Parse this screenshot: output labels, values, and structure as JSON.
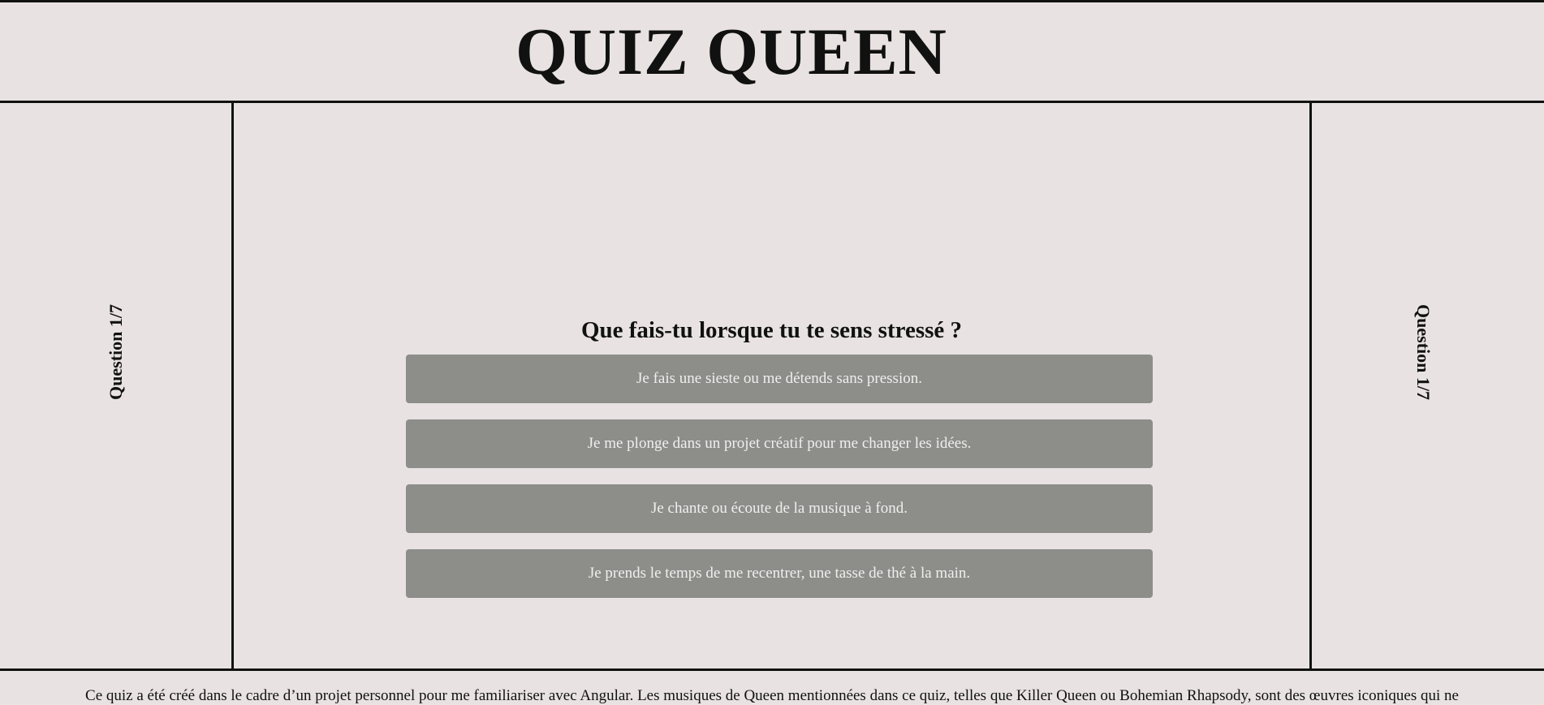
{
  "header": {
    "title": "QUIZ QUEEN"
  },
  "progress": {
    "left_label": "Question 1/7",
    "right_label": "Question 1/7",
    "current": 1,
    "total": 7
  },
  "quiz": {
    "question": "Que fais-tu lorsque tu te sens stressé ?",
    "answers": [
      "Je fais une sieste ou me détends sans pression.",
      "Je me plonge dans un projet créatif pour me changer les idées.",
      "Je chante ou écoute de la musique à fond.",
      "Je prends le temps de me recentrer, une tasse de thé à la main."
    ]
  },
  "footer": {
    "text": "Ce quiz a été créé dans le cadre d’un projet personnel pour me familiariser avec Angular. Les musiques de Queen mentionnées dans ce quiz, telles que Killer Queen ou Bohemian Rhapsody, sont des œuvres iconiques qui ne"
  },
  "colors": {
    "background": "#e8e3e2",
    "answer_button": "#8d8d8a",
    "answer_text": "#efefef",
    "lines": "#111111"
  }
}
